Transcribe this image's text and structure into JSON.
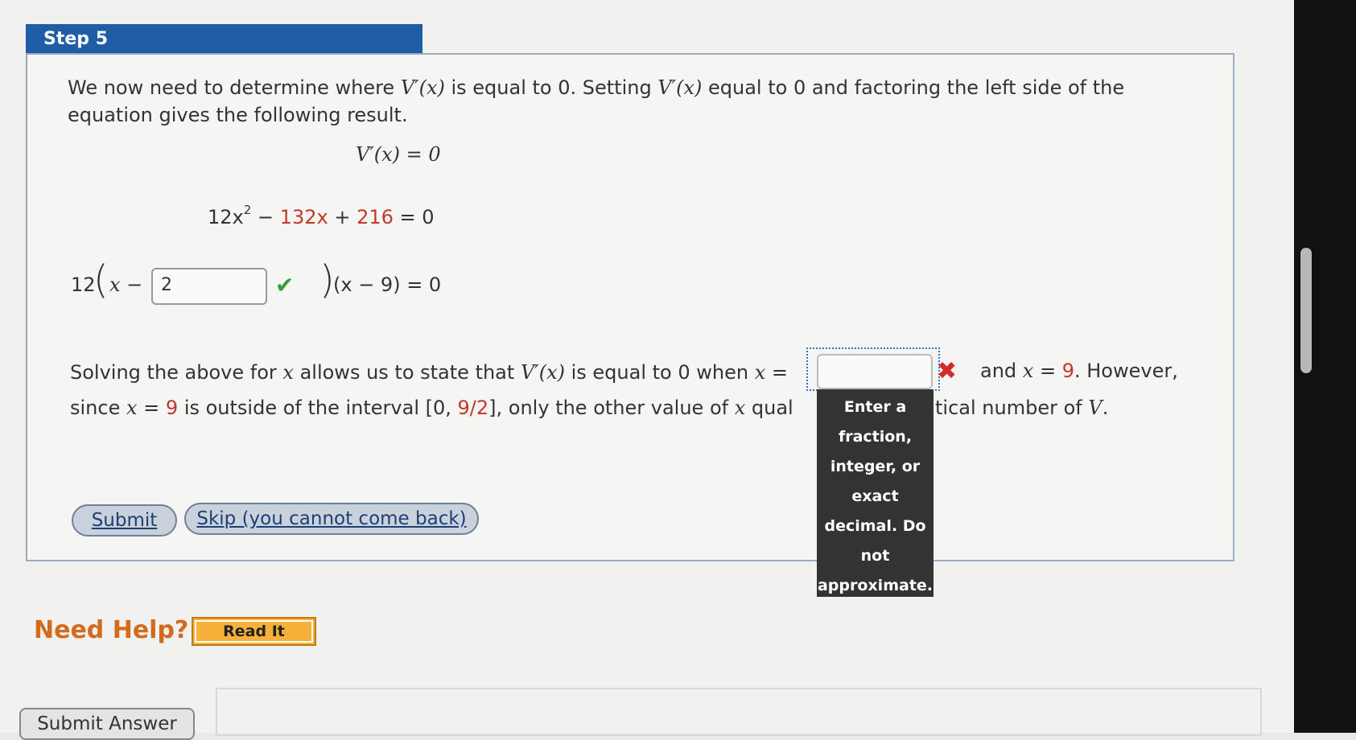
{
  "step": {
    "title": "Step 5"
  },
  "intro": {
    "line1_a": "We now need to determine where ",
    "vprime": "V′(x)",
    "line1_b": " is equal to 0. Setting ",
    "line1_c": " equal to 0 and factoring the left side of the",
    "line2": "equation gives the following result."
  },
  "equations": {
    "eq1": "V′(x)  =  0",
    "eq2_a": "12x",
    "eq2_sup": "2",
    "eq2_b": " − ",
    "eq2_c": "132x",
    "eq2_d": " + ",
    "eq2_e": "216",
    "eq2_f": "  =  0",
    "eq3_a": "12",
    "eq3_x": "x −",
    "eq3_input_value": "2",
    "eq3_b": "(x − 9)  =  0"
  },
  "solve": {
    "line1_a": "Solving the above for ",
    "x": "x",
    "line1_b": " allows us to state that ",
    "line1_c": " is equal to 0 when ",
    "line1_d": " =",
    "line1_e": " and ",
    "line1_f": " = ",
    "nine": "9",
    "line1_g": ". However,",
    "line2_a": "since ",
    "line2_b": " is outside of the interval [0, ",
    "frac": "9/2",
    "line2_c": "], only the other value of ",
    "line2_d": " qual",
    "line2_e": "tical number of ",
    "V": "V",
    "line2_f": "."
  },
  "tooltip": [
    "Enter a",
    "fraction,",
    "integer, or",
    "exact",
    "decimal. Do",
    "not",
    "approximate."
  ],
  "buttons": {
    "submit": "Submit",
    "skip": "Skip (you cannot come back)",
    "read_it": "Read It",
    "submit_answer": "Submit Answer"
  },
  "help": {
    "label": "Need Help?"
  },
  "colors": {
    "tab": "#1f5da6",
    "accent_red": "#c0392b",
    "help_orange": "#d46a1b",
    "check_green": "#3c9a3c"
  },
  "icons": {
    "correct": "check-icon",
    "incorrect": "x-icon"
  }
}
